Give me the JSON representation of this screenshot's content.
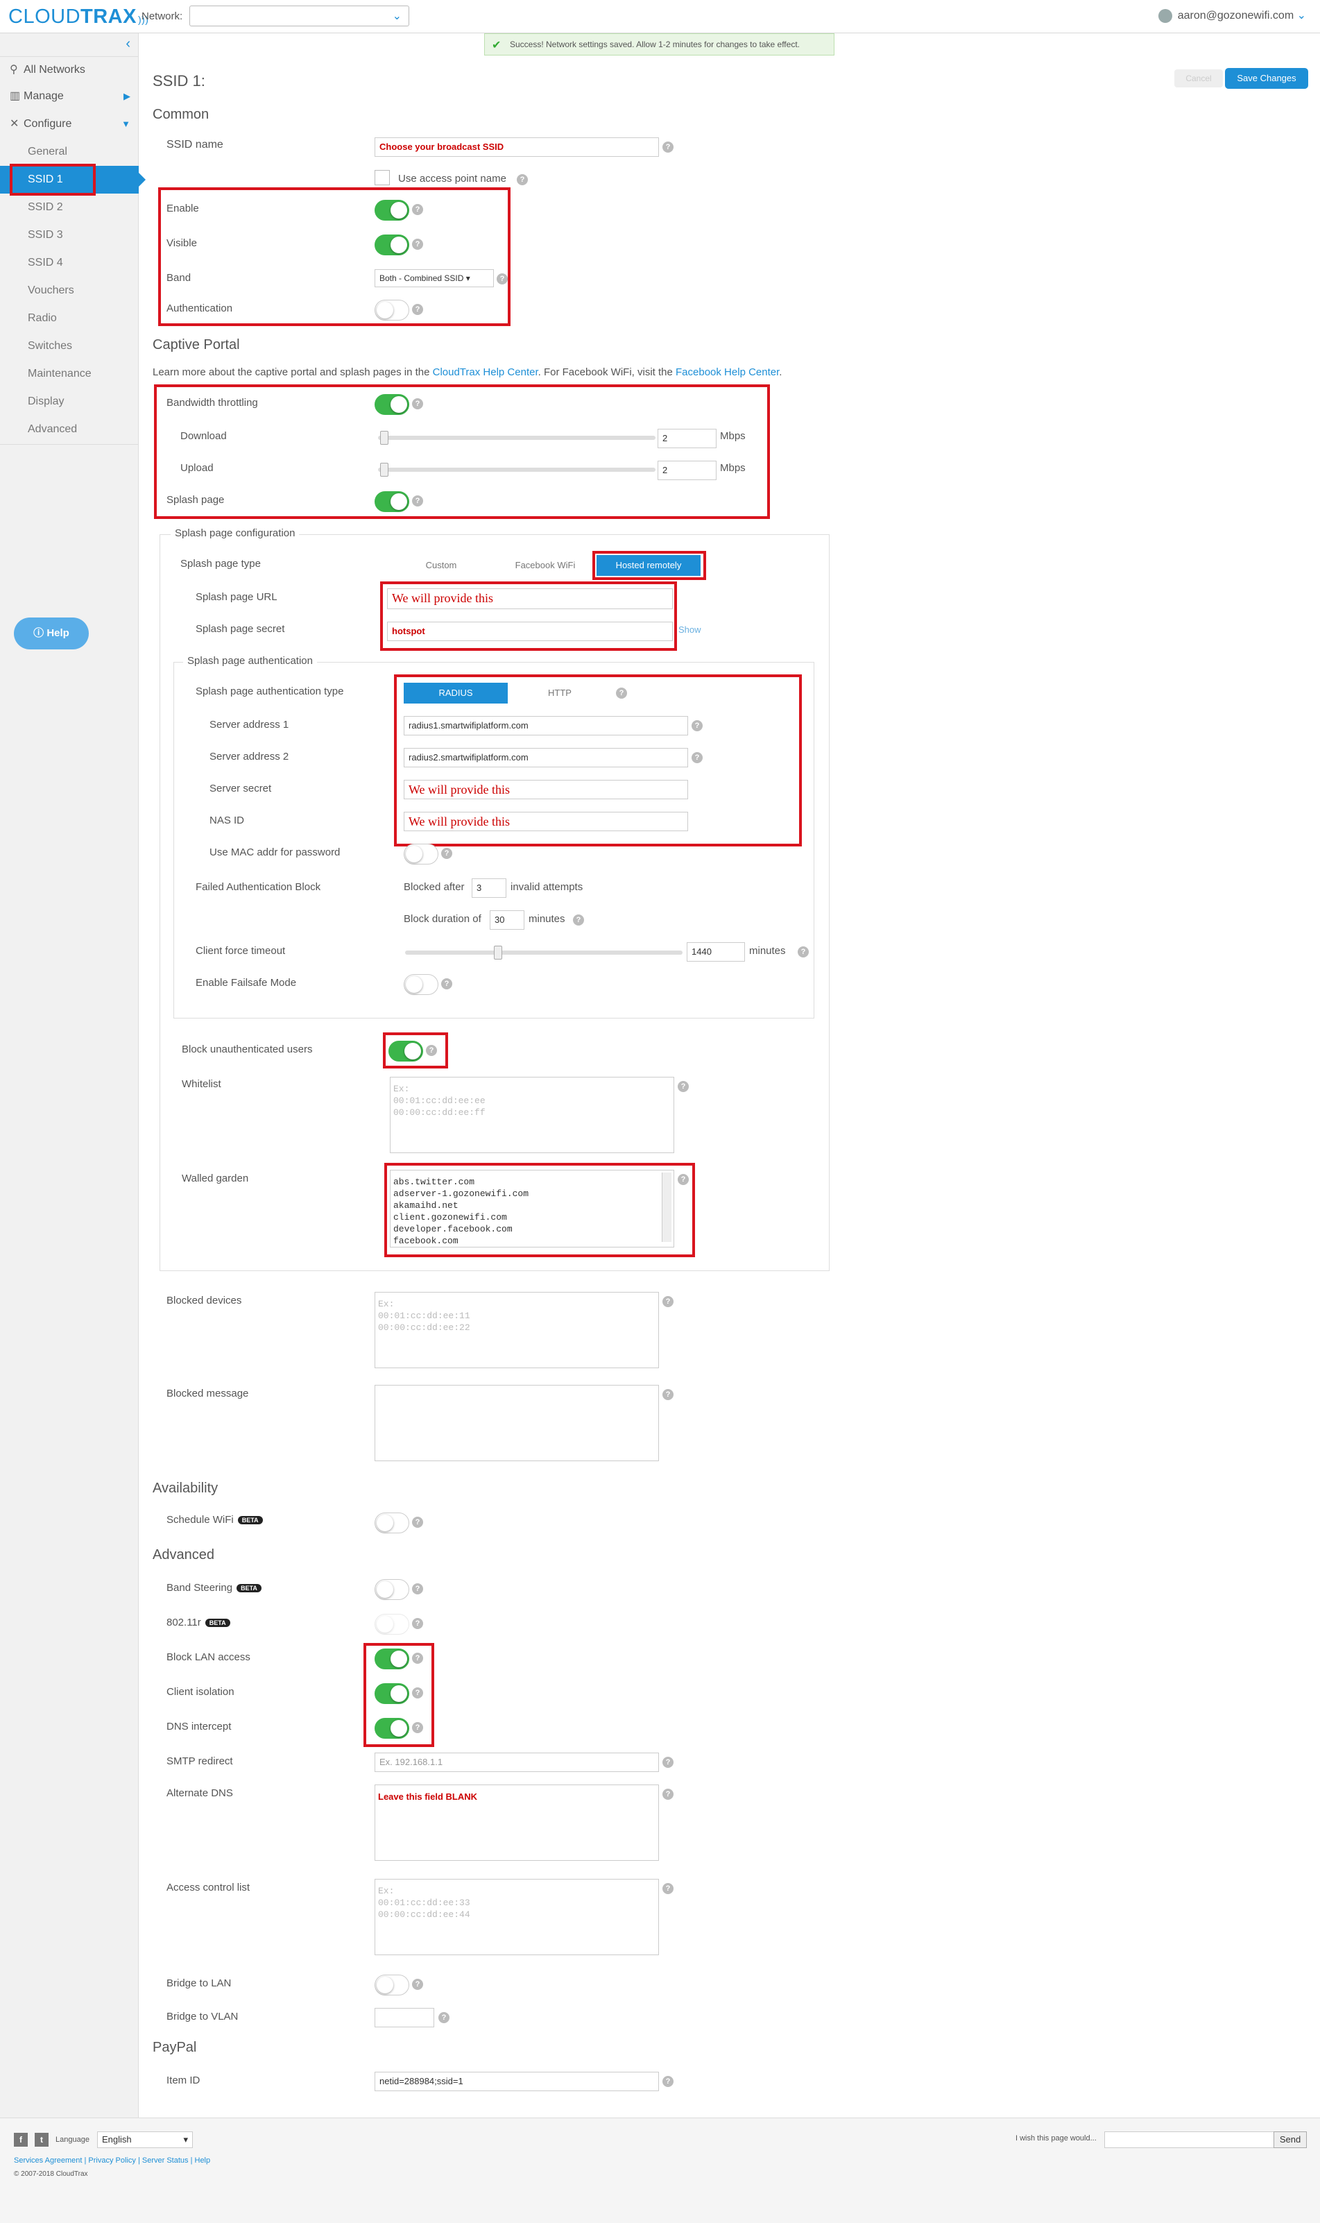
{
  "header": {
    "logo_light": "CLOUD",
    "logo_bold": "TRAX",
    "network_label": "Network:",
    "network_value": "",
    "user_email": "aaron@gozonewifi.com"
  },
  "notice": "Success! Network settings saved. Allow 1-2 minutes for changes to take effect.",
  "actions": {
    "cancel": "Cancel",
    "save": "Save Changes"
  },
  "sidebar": {
    "top": [
      {
        "label": "All Networks"
      },
      {
        "label": "Manage"
      },
      {
        "label": "Configure"
      }
    ],
    "items": [
      {
        "label": "General"
      },
      {
        "label": "SSID 1"
      },
      {
        "label": "SSID 2"
      },
      {
        "label": "SSID 3"
      },
      {
        "label": "SSID 4"
      },
      {
        "label": "Vouchers"
      },
      {
        "label": "Radio"
      },
      {
        "label": "Switches"
      },
      {
        "label": "Maintenance"
      },
      {
        "label": "Display"
      },
      {
        "label": "Advanced"
      }
    ],
    "help": "Help"
  },
  "page": {
    "title": "SSID 1:",
    "common": {
      "heading": "Common",
      "ssid_name_label": "SSID name",
      "ssid_name_value": "Choose your broadcast SSID",
      "use_ap_name": "Use access point name",
      "enable": "Enable",
      "visible": "Visible",
      "band": "Band",
      "band_value": "Both - Combined SSID",
      "authentication": "Authentication"
    },
    "captive": {
      "heading": "Captive Portal",
      "intro_1": "Learn more about the captive portal and splash pages in the ",
      "intro_link1": "CloudTrax Help Center",
      "intro_2": ". For Facebook WiFi, visit the ",
      "intro_link2": "Facebook Help Center",
      "intro_3": ".",
      "bandwidth": "Bandwidth throttling",
      "download": "Download",
      "download_value": "2",
      "upload": "Upload",
      "upload_value": "2",
      "unit": "Mbps",
      "splash_page": "Splash page"
    },
    "splash_config": {
      "legend": "Splash page configuration",
      "type_label": "Splash page type",
      "types": [
        "Custom",
        "Facebook WiFi",
        "Hosted remotely"
      ],
      "url_label": "Splash page URL",
      "url_value": "We will provide this",
      "secret_label": "Splash page secret",
      "secret_value": "hotspot",
      "show": "Show"
    },
    "splash_auth": {
      "legend": "Splash page authentication",
      "type_label": "Splash page authentication type",
      "types": [
        "RADIUS",
        "HTTP"
      ],
      "server1_label": "Server address 1",
      "server1_value": "radius1.smartwifiplatform.com",
      "server2_label": "Server address 2",
      "server2_value": "radius2.smartwifiplatform.com",
      "secret_label": "Server secret",
      "secret_value": "We will provide this",
      "nas_label": "NAS ID",
      "nas_value": "We will provide this",
      "mac_label": "Use MAC addr for password",
      "failed_label": "Failed Authentication Block",
      "blocked_after": "Blocked after",
      "blocked_after_value": "3",
      "invalid_attempts": "invalid attempts",
      "block_duration": "Block duration of",
      "block_duration_value": "30",
      "minutes": "minutes",
      "timeout_label": "Client force timeout",
      "timeout_value": "1440",
      "timeout_unit": "minutes",
      "failsafe_label": "Enable Failsafe Mode"
    },
    "block_unauth": "Block unauthenticated users",
    "whitelist_label": "Whitelist",
    "whitelist_placeholder": "Ex:\n00:01:cc:dd:ee:ee\n00:00:cc:dd:ee:ff",
    "walled_label": "Walled garden",
    "walled_value": "abs.twitter.com\nadserver-1.gozonewifi.com\nakamaihd.net\nclient.gozonewifi.com\ndeveloper.facebook.com\nfacebook.com",
    "blocked_devices_label": "Blocked devices",
    "blocked_devices_placeholder": "Ex:\n00:01:cc:dd:ee:11\n00:00:cc:dd:ee:22",
    "blocked_message_label": "Blocked message",
    "availability": {
      "heading": "Availability",
      "schedule": "Schedule WiFi",
      "beta": "BETA"
    },
    "advanced": {
      "heading": "Advanced",
      "band_steering": "Band Steering",
      "r80211": "802.11r",
      "beta": "BETA",
      "block_lan": "Block LAN access",
      "client_isolation": "Client isolation",
      "dns_intercept": "DNS intercept",
      "smtp": "SMTP redirect",
      "smtp_placeholder": "Ex. 192.168.1.1",
      "alt_dns": "Alternate DNS",
      "alt_dns_value": "Leave this field BLANK",
      "acl": "Access control list",
      "acl_placeholder": "Ex:\n00:01:cc:dd:ee:33\n00:00:cc:dd:ee:44",
      "bridge_lan": "Bridge to LAN",
      "bridge_vlan": "Bridge to VLAN"
    },
    "paypal": {
      "heading": "PayPal",
      "item_id": "Item ID",
      "item_value": "netid=288984;ssid=1"
    }
  },
  "footer": {
    "language_label": "Language",
    "language_value": "English",
    "wish_label": "I wish this page would...",
    "send": "Send",
    "links": [
      "Services Agreement",
      "Privacy Policy",
      "Server Status",
      "Help"
    ],
    "copyright": "© 2007-2018 CloudTrax"
  }
}
